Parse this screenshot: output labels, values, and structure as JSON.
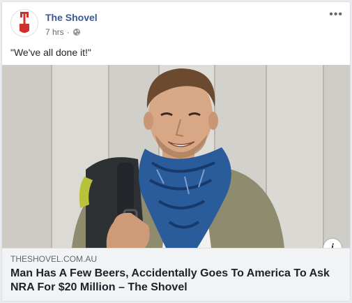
{
  "post": {
    "page_name": "The Shovel",
    "time": "7 hrs",
    "separator": "·",
    "privacy_icon": "globe-icon",
    "more_icon": "more-options-icon",
    "more_label": "•••",
    "text": "\"We've all done it!\""
  },
  "link": {
    "domain": "THESHOVEL.COM.AU",
    "headline": "Man Has A Few Beers, Accidentally Goes To America To Ask NRA For $20 Million – The Shovel",
    "info_label": "i"
  },
  "colors": {
    "page_name": "#385898",
    "logo_red": "#d0302b",
    "caption_bg": "#f2f3f5"
  }
}
